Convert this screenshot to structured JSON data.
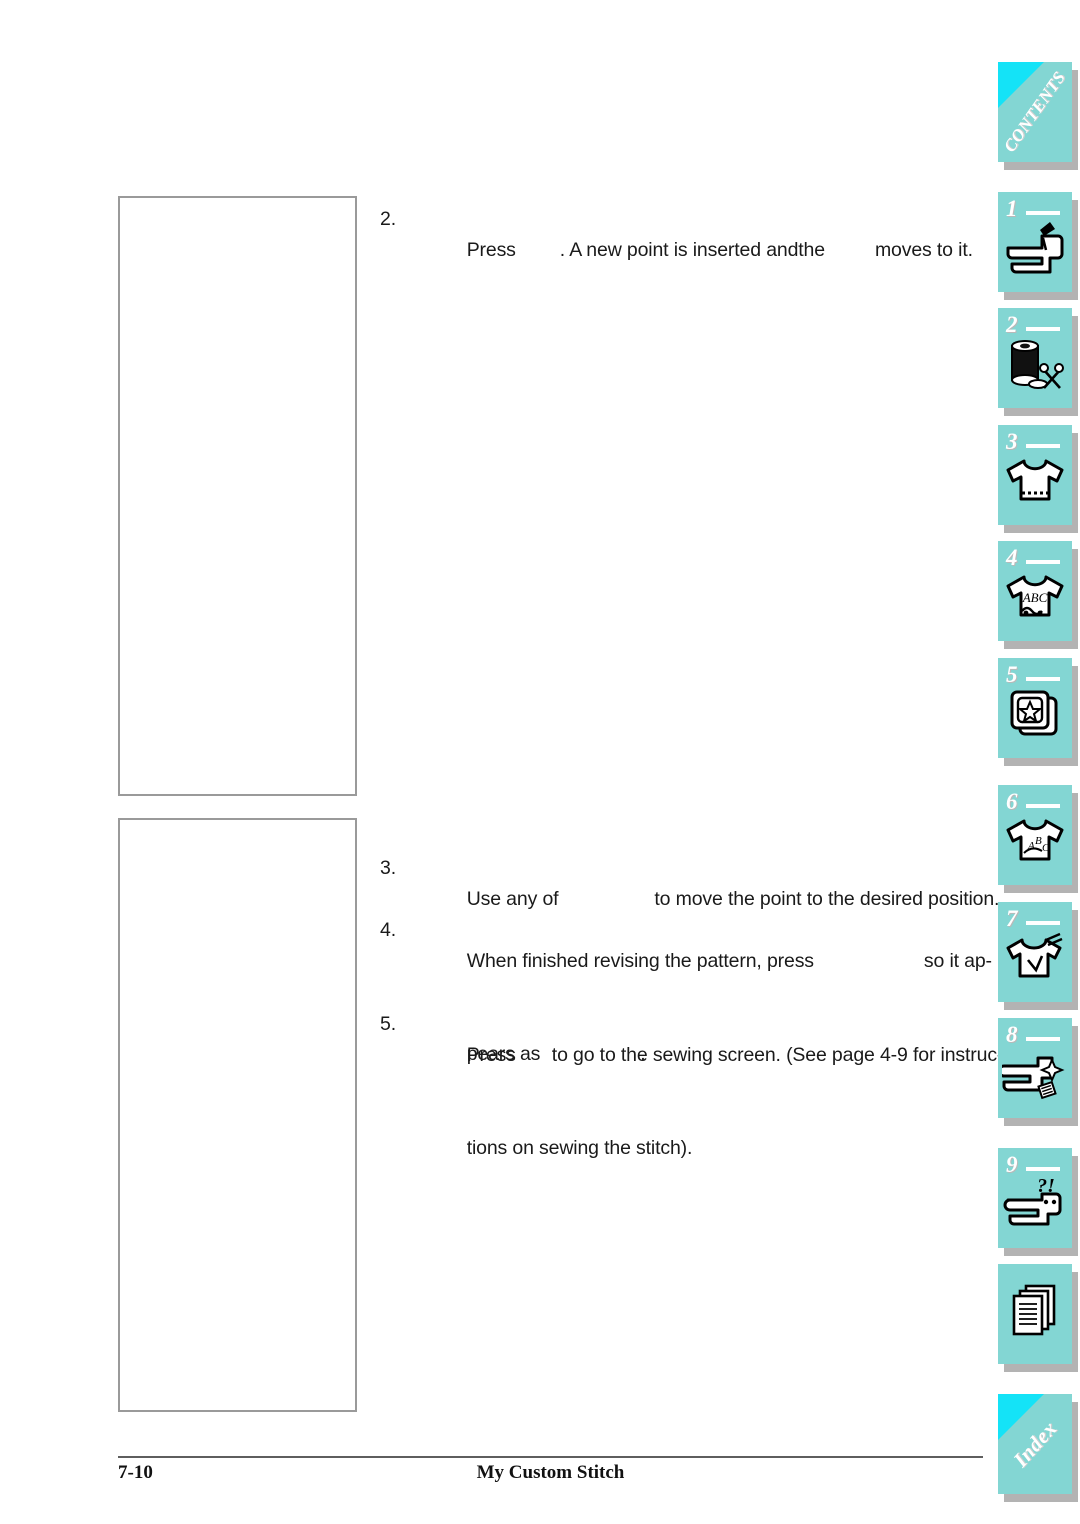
{
  "page": {
    "chapter_label": "My Custom Stitch",
    "page_number": "7-10"
  },
  "figures": [
    {
      "name": "screen-illustration-insert-point",
      "caption": ""
    },
    {
      "name": "screen-illustration-move-point",
      "caption": ""
    }
  ],
  "steps": [
    {
      "number": "2.",
      "line1_a": "Press",
      "line1_b": ". A new point is inserted and",
      "line1_c": "the",
      "line1_d": "moves to it.",
      "inline_images": [
        "insert-point-key",
        "cursor-indicator"
      ]
    },
    {
      "number": "3.",
      "line1_a": "Use any of",
      "line1_b": "to move the point to the desired position.",
      "inline_images": [
        "arrow-keys"
      ]
    },
    {
      "number": "4.",
      "line1_a": "When finished revising the pattern, press",
      "line1_b": "so it ap-",
      "line2_a": "pears as",
      "line2_b": ".",
      "inline_images": [
        "set-button",
        "set-button-pressed"
      ]
    },
    {
      "number": "5.",
      "line1_a": "Press",
      "line1_b": "to go to the sewing screen. (See page 4-9 for instruc-",
      "line2_a": "tions on sewing the stitch).",
      "inline_images": [
        "ok-button"
      ]
    }
  ],
  "tabs": [
    {
      "id": "contents",
      "type": "word",
      "label": "CONTENTS",
      "number": "",
      "icon": "contents-tab"
    },
    {
      "id": "ch1",
      "type": "number",
      "label": "",
      "number": "1",
      "icon": "sewing-machine-needle-icon"
    },
    {
      "id": "ch2",
      "type": "number",
      "label": "",
      "number": "2",
      "icon": "thread-spool-scissors-icon"
    },
    {
      "id": "ch3",
      "type": "number",
      "label": "",
      "number": "3",
      "icon": "shirt-stitch-icon"
    },
    {
      "id": "ch4",
      "type": "number",
      "label": "",
      "number": "4",
      "icon": "shirt-abc-icon"
    },
    {
      "id": "ch5",
      "type": "number",
      "label": "",
      "number": "5",
      "icon": "embroidery-card-star-icon"
    },
    {
      "id": "ch6",
      "type": "number",
      "label": "",
      "number": "6",
      "icon": "shirt-lettering-icon"
    },
    {
      "id": "ch7",
      "type": "number",
      "label": "",
      "number": "7",
      "icon": "shirt-custom-stitch-icon"
    },
    {
      "id": "ch8",
      "type": "number",
      "label": "",
      "number": "8",
      "icon": "sewing-machine-settings-icon"
    },
    {
      "id": "ch9",
      "type": "number",
      "label": "",
      "number": "9",
      "icon": "sewing-machine-question-icon"
    },
    {
      "id": "appendix",
      "type": "plain",
      "label": "",
      "number": "",
      "icon": "pages-stack-icon"
    },
    {
      "id": "index",
      "type": "word",
      "label": "Index",
      "number": "",
      "icon": "index-tab"
    }
  ],
  "colors": {
    "tab_teal": "#83d6d3",
    "tab_corner_cyan": "#14e3f7",
    "tab_shadow": "#b3b3b3",
    "frame_border": "#9a9a9a",
    "text": "#1a1a1a"
  }
}
